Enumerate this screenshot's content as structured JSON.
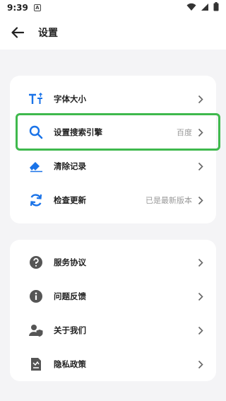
{
  "status_bar": {
    "time": "9:39",
    "notif_icon": "A"
  },
  "app_bar": {
    "title": "设置"
  },
  "section1": [
    {
      "label": "字体大小",
      "value": ""
    },
    {
      "label": "设置搜索引擎",
      "value": "百度"
    },
    {
      "label": "清除记录",
      "value": ""
    },
    {
      "label": "检查更新",
      "value": "已是最新版本"
    }
  ],
  "section2": [
    {
      "label": "服务协议"
    },
    {
      "label": "问题反馈"
    },
    {
      "label": "关于我们"
    },
    {
      "label": "隐私政策"
    }
  ],
  "colors": {
    "accent": "#1a73e8",
    "highlight": "#3fb94d",
    "icon_gray": "#555555"
  }
}
